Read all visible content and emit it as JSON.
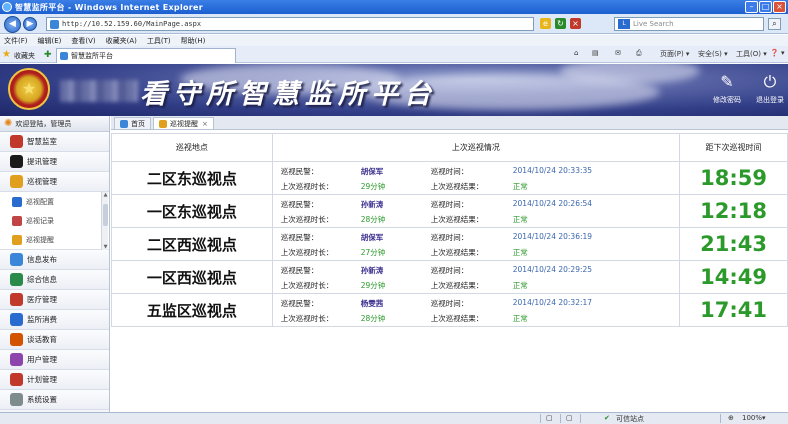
{
  "browser": {
    "title": "智慧监所平台 - Windows Internet Explorer",
    "url": "http://10.52.159.60/MainPage.aspx",
    "search_placeholder": "Live Search",
    "menu": [
      "文件(F)",
      "编辑(E)",
      "查看(V)",
      "收藏夹(A)",
      "工具(T)",
      "帮助(H)"
    ],
    "favorites_label": "收藏夹",
    "tab_title": "智慧监所平台",
    "commands": {
      "page": "页面(P) ▾",
      "safety": "安全(S) ▾",
      "tools": "工具(O) ▾",
      "help": "❓ ▾"
    }
  },
  "header": {
    "title": "看守所智慧监所平台",
    "change_password": "修改密码",
    "logout": "退出登录"
  },
  "sidebar": {
    "welcome": "欢迎登陆，管理员",
    "items_top": [
      {
        "label": "智慧监室",
        "icon": "user-icon",
        "color": "#c0392b"
      },
      {
        "label": "提讯管理",
        "icon": "person-icon",
        "color": "#1a1a1a"
      },
      {
        "label": "巡视管理",
        "icon": "patrol-icon",
        "color": "#e0a01d"
      }
    ],
    "subitems": [
      {
        "label": "巡视配置",
        "icon": "config-icon",
        "color": "#2a6bd0"
      },
      {
        "label": "巡视记录",
        "icon": "record-icon",
        "color": "#c24545"
      },
      {
        "label": "巡视提醒",
        "icon": "alarm-icon",
        "color": "#e0a01d"
      }
    ],
    "items_bottom": [
      {
        "label": "信息发布",
        "icon": "info-icon",
        "color": "#3b86d8"
      },
      {
        "label": "综合信息",
        "icon": "eye-icon",
        "color": "#2a8a4a"
      },
      {
        "label": "医疗管理",
        "icon": "medical-icon",
        "color": "#c0392b"
      },
      {
        "label": "监所消费",
        "icon": "cart-icon",
        "color": "#2a6bd0"
      },
      {
        "label": "谈话教育",
        "icon": "talk-icon",
        "color": "#d35400"
      },
      {
        "label": "用户管理",
        "icon": "users-icon",
        "color": "#8e44ad"
      },
      {
        "label": "计划管理",
        "icon": "plan-icon",
        "color": "#c0392b"
      },
      {
        "label": "系统设置",
        "icon": "gear-icon",
        "color": "#7f8c8d"
      }
    ]
  },
  "tabs": [
    {
      "label": "首页",
      "icon": "home-icon"
    },
    {
      "label": "巡视提醒",
      "icon": "alarm-icon",
      "close": "×"
    }
  ],
  "table": {
    "headers": [
      "巡视地点",
      "上次巡视情况",
      "距下次巡视时间"
    ],
    "labels": {
      "officer": "巡视民警：",
      "time": "巡视时间：",
      "duration": "上次巡视时长：",
      "result": "上次巡视结果："
    },
    "rows": [
      {
        "place": "二区东巡视点",
        "officer": "胡保军",
        "time": "2014/10/24 20:33:35",
        "duration": "29分钟",
        "result": "正常",
        "next": "18:59"
      },
      {
        "place": "一区东巡视点",
        "officer": "孙新涛",
        "time": "2014/10/24 20:26:54",
        "duration": "28分钟",
        "result": "正常",
        "next": "12:18"
      },
      {
        "place": "二区西巡视点",
        "officer": "胡保军",
        "time": "2014/10/24 20:36:19",
        "duration": "27分钟",
        "result": "正常",
        "next": "21:43"
      },
      {
        "place": "一区西巡视点",
        "officer": "孙新涛",
        "time": "2014/10/24 20:29:25",
        "duration": "29分钟",
        "result": "正常",
        "next": "14:49"
      },
      {
        "place": "五监区巡视点",
        "officer": "杨雯茜",
        "time": "2014/10/24 20:32:17",
        "duration": "28分钟",
        "result": "正常",
        "next": "17:41"
      }
    ]
  },
  "statusbar": {
    "zone": "可信站点",
    "zoom": "100%"
  }
}
